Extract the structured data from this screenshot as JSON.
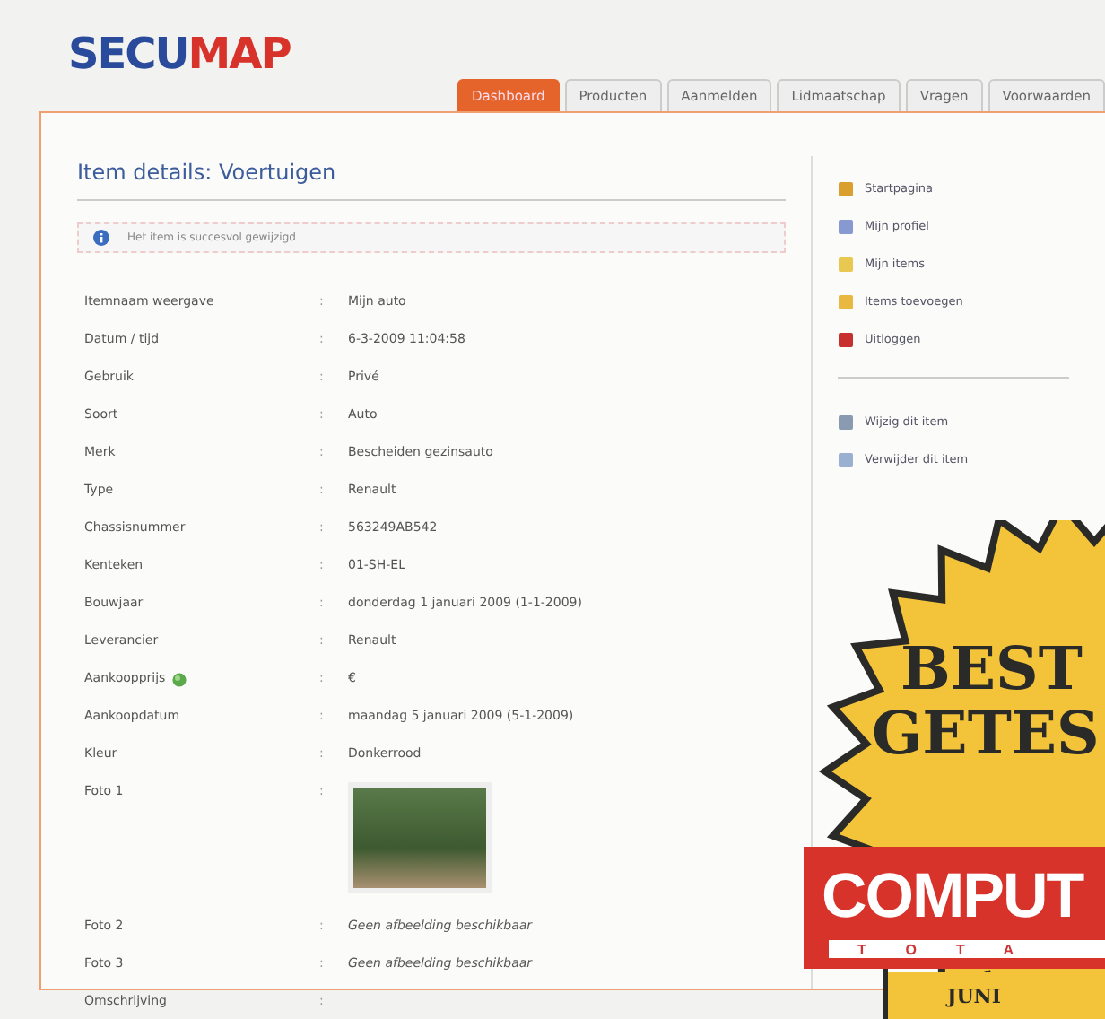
{
  "logo": {
    "part_1": "SECU",
    "part_2": "MAP"
  },
  "tabs": [
    {
      "label": "Dashboard",
      "selected": true
    },
    {
      "label": "Producten",
      "selected": false
    },
    {
      "label": "Aanmelden",
      "selected": false
    },
    {
      "label": "Lidmaatschap",
      "selected": false
    },
    {
      "label": "Vragen",
      "selected": false
    },
    {
      "label": "Voorwaarden",
      "selected": false
    }
  ],
  "heading": "Item details: Voertuigen",
  "alert": "Het item is succesvol gewijzigd",
  "separator": ":",
  "details": [
    {
      "kind": "text",
      "label": "Itemnaam weergave",
      "value": "Mijn auto"
    },
    {
      "kind": "text",
      "label": "Datum / tijd",
      "value": "6-3-2009 11:04:58"
    },
    {
      "kind": "text",
      "label": "Gebruik",
      "value": "Privé"
    },
    {
      "kind": "text",
      "label": "Soort",
      "value": "Auto"
    },
    {
      "kind": "text",
      "label": "Merk",
      "value": "Bescheiden gezinsauto"
    },
    {
      "kind": "text",
      "label": "Type",
      "value": "Renault"
    },
    {
      "kind": "text",
      "label": "Chassisnummer",
      "value": "563249AB542"
    },
    {
      "kind": "text",
      "label": "Kenteken",
      "value": "01-SH-EL"
    },
    {
      "kind": "text",
      "label": "Bouwjaar",
      "value": "donderdag 1 januari 2009 (1-1-2009)"
    },
    {
      "kind": "text",
      "label": "Leverancier",
      "value": "Renault"
    },
    {
      "kind": "price",
      "label": "Aankoopprijs",
      "value": "€"
    },
    {
      "kind": "text",
      "label": "Aankoopdatum",
      "value": "maandag 5 januari 2009 (5-1-2009)"
    },
    {
      "kind": "text",
      "label": "Kleur",
      "value": "Donkerrood"
    },
    {
      "kind": "photo",
      "label": "Foto 1"
    },
    {
      "kind": "missing",
      "label": "Foto 2",
      "value": "Geen afbeelding beschikbaar"
    },
    {
      "kind": "missing",
      "label": "Foto 3",
      "value": "Geen afbeelding beschikbaar"
    },
    {
      "kind": "text",
      "label": "Omschrijving"
    }
  ],
  "sidebar": {
    "menu": [
      {
        "label": "Startpagina"
      },
      {
        "label": "Mijn profiel"
      },
      {
        "label": "Mijn items"
      },
      {
        "label": "Items toevoegen"
      },
      {
        "label": "Uitloggen"
      }
    ],
    "actions": [
      {
        "label": "Wijzig dit item"
      },
      {
        "label": "Verwijder dit item"
      }
    ]
  },
  "award": {
    "line_1": "BEST",
    "line_2": "GETES",
    "brand": "COMPUT",
    "brand_sub": "TOTA",
    "month": "JUNI"
  }
}
